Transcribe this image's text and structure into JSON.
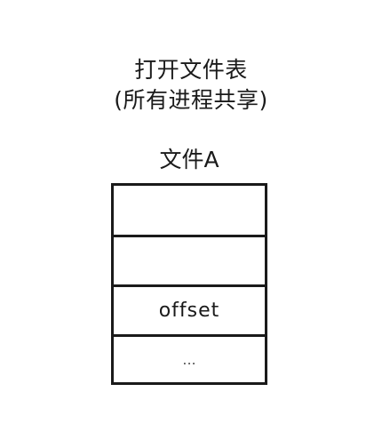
{
  "title": {
    "line1": "打开文件表",
    "line2": "(所有进程共享)"
  },
  "file": {
    "label": "文件A"
  },
  "table": {
    "cells": [
      "",
      "",
      "offset",
      "..."
    ]
  }
}
